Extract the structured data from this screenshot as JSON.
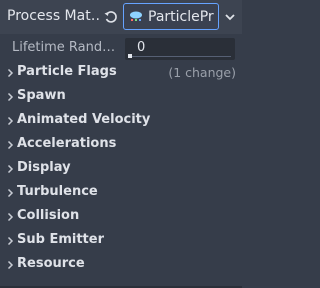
{
  "header": {
    "title": "Process Mat…",
    "revert_icon": "revert-icon",
    "resource_button_label": "ParticlePr",
    "resource_icon": "particle-process-material-icon",
    "dropdown_icon": "chevron-down-icon"
  },
  "property": {
    "label": "Lifetime Rand…",
    "value": "0",
    "slider_fraction": 0
  },
  "sections": [
    {
      "label": "Particle Flags",
      "note": "(1 change)"
    },
    {
      "label": "Spawn",
      "note": ""
    },
    {
      "label": "Animated Velocity",
      "note": ""
    },
    {
      "label": "Accelerations",
      "note": ""
    },
    {
      "label": "Display",
      "note": ""
    },
    {
      "label": "Turbulence",
      "note": ""
    },
    {
      "label": "Collision",
      "note": ""
    },
    {
      "label": "Sub Emitter",
      "note": ""
    },
    {
      "label": "Resource",
      "note": ""
    }
  ],
  "colors": {
    "accent": "#66a3ff",
    "background": "#363d4a",
    "field": "#2a2f38"
  }
}
